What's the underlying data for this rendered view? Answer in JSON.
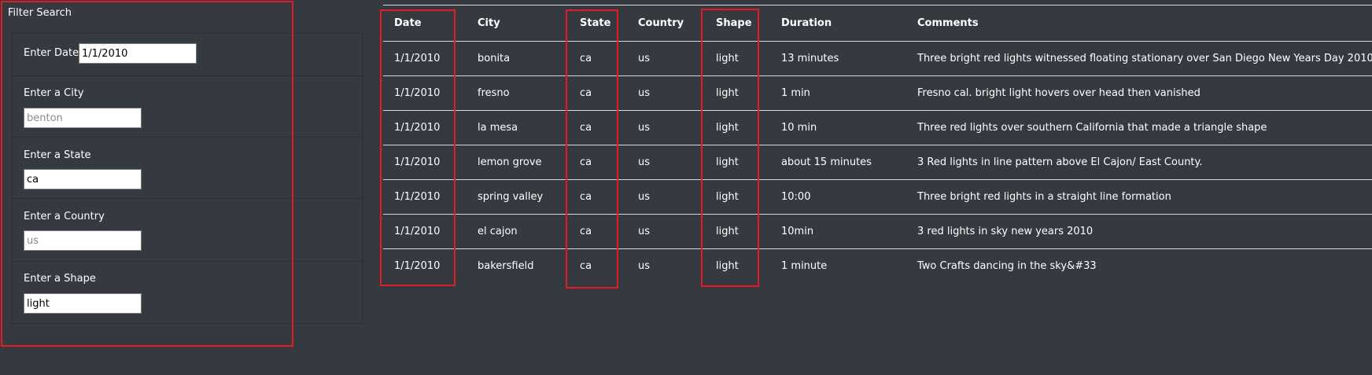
{
  "filter": {
    "title": "Filter Search",
    "date_label": "Enter Date",
    "date_value": "1/1/2010",
    "city_label": "Enter a City",
    "city_placeholder": "benton",
    "state_label": "Enter a State",
    "state_value": "ca",
    "country_label": "Enter a Country",
    "country_placeholder": "us",
    "shape_label": "Enter a Shape",
    "shape_value": "light"
  },
  "table": {
    "headers": [
      "Date",
      "City",
      "State",
      "Country",
      "Shape",
      "Duration",
      "Comments"
    ],
    "rows": [
      [
        "1/1/2010",
        "bonita",
        "ca",
        "us",
        "light",
        "13 minutes",
        "Three bright red lights witnessed floating stationary over San Diego New Years Day 2010"
      ],
      [
        "1/1/2010",
        "fresno",
        "ca",
        "us",
        "light",
        "1 min",
        "Fresno cal. bright light hovers over head then vanished"
      ],
      [
        "1/1/2010",
        "la mesa",
        "ca",
        "us",
        "light",
        "10 min",
        "Three red lights over southern California that made a triangle shape"
      ],
      [
        "1/1/2010",
        "lemon grove",
        "ca",
        "us",
        "light",
        "about 15 minutes",
        "3 Red lights in line pattern above El Cajon/ East County."
      ],
      [
        "1/1/2010",
        "spring valley",
        "ca",
        "us",
        "light",
        "10:00",
        "Three bright red lights in a straight line formation"
      ],
      [
        "1/1/2010",
        "el cajon",
        "ca",
        "us",
        "light",
        "10min",
        "3 red lights in sky new years 2010"
      ],
      [
        "1/1/2010",
        "bakersfield",
        "ca",
        "us",
        "light",
        "1 minute",
        "Two Crafts dancing in the sky&#33"
      ]
    ]
  },
  "colors": {
    "background": "#343a40",
    "highlight": "#e31b23",
    "rule": "#d8d8d8"
  }
}
